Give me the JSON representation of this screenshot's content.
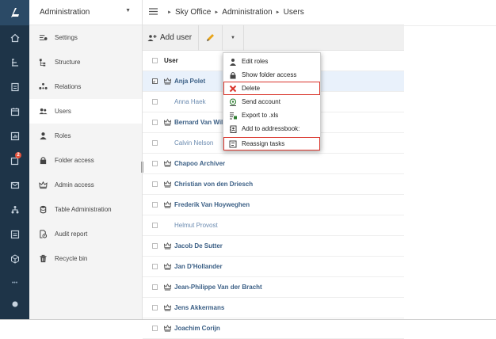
{
  "sidebar": {
    "title": "Administration",
    "items": [
      {
        "label": "Settings",
        "icon": "settings-icon"
      },
      {
        "label": "Structure",
        "icon": "structure-icon"
      },
      {
        "label": "Relations",
        "icon": "relations-icon"
      },
      {
        "label": "Users",
        "icon": "users-icon",
        "active": true
      },
      {
        "label": "Roles",
        "icon": "roles-icon"
      },
      {
        "label": "Folder access",
        "icon": "folder-lock-icon"
      },
      {
        "label": "Admin access",
        "icon": "crown-icon"
      },
      {
        "label": "Table Administration",
        "icon": "database-icon"
      },
      {
        "label": "Audit report",
        "icon": "audit-icon"
      },
      {
        "label": "Recycle bin",
        "icon": "recycle-bin-icon"
      }
    ]
  },
  "rail": {
    "badge": "2",
    "more": "•••"
  },
  "breadcrumb": [
    "Sky Office",
    "Administration",
    "Users"
  ],
  "toolbar": {
    "add_user": "Add user"
  },
  "table": {
    "header": "User",
    "rows": [
      {
        "name": "Anja Polet",
        "admin": true,
        "selected": true
      },
      {
        "name": "Anna Haek",
        "admin": false
      },
      {
        "name": "Bernard Van Wild",
        "admin": true
      },
      {
        "name": "Calvin Nelson",
        "admin": false
      },
      {
        "name": "Chapoo Archiver",
        "admin": true
      },
      {
        "name": "Christian von den Driesch",
        "admin": true
      },
      {
        "name": "Frederik Van Hoyweghen",
        "admin": true
      },
      {
        "name": "Helmut Provost",
        "admin": false
      },
      {
        "name": "Jacob De Sutter",
        "admin": true
      },
      {
        "name": "Jan D'Hollander",
        "admin": true
      },
      {
        "name": "Jean-Philippe Van der Bracht",
        "admin": true
      },
      {
        "name": "Jens Akkermans",
        "admin": true
      },
      {
        "name": "Joachim Corijn",
        "admin": true
      }
    ]
  },
  "menu": {
    "items": [
      {
        "label": "Edit roles",
        "icon": "user-icon"
      },
      {
        "label": "Show folder access",
        "icon": "lock-icon"
      },
      {
        "label": "Delete",
        "icon": "close-icon",
        "highlight": true
      },
      {
        "label": "Send account",
        "icon": "send-account-icon"
      },
      {
        "label": "Export to .xls",
        "icon": "export-icon"
      },
      {
        "label": "Add to addressbook:",
        "icon": "addressbook-icon"
      },
      {
        "label": "Reassign tasks",
        "icon": "reassign-icon",
        "highlight": true
      }
    ]
  },
  "colors": {
    "rail": "#1e3448",
    "highlight": "#d9342b",
    "link": "#3b5f85",
    "crown": "#555555"
  }
}
